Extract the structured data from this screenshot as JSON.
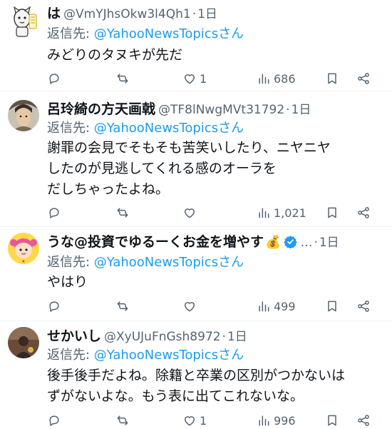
{
  "reply_prefix": "返信先: ",
  "tweets": [
    {
      "name": "は",
      "handle": "@VmYJhsOkw3l4Qh1",
      "sep": "·",
      "time": "1日",
      "reply_to": "@YahooNewsTopicsさん",
      "body": "みどりのタヌキが先だ",
      "likes": "1",
      "views": "686",
      "avatar": "cartoon-character"
    },
    {
      "name": "呂玲綺の方天画戟",
      "handle": "@TF8lNwgMVt31792",
      "sep": "·",
      "time": "1日",
      "reply_to": "@YahooNewsTopicsさん",
      "body": "謝罪の会見でそもそも苦笑いしたり、ニヤニヤ\nしたのが見逃してくれる感のオーラを\nだしちゃったよね。",
      "likes": "",
      "views": "1,021",
      "avatar": "game-character-portrait"
    },
    {
      "name": "うな@投資でゆるーくお金を増やす",
      "handle": "…",
      "sep": "·",
      "time": "1日",
      "reply_to": "@YahooNewsTopicsさん",
      "body": "やはり",
      "likes": "",
      "views": "499",
      "avatar": "cartoon-girl",
      "verified_color": "#1d9bf0",
      "name_emoji": "💰"
    },
    {
      "name": "せかいし",
      "handle": "@XyUJuFnGsh8972",
      "sep": "·",
      "time": "1日",
      "reply_to": "@YahooNewsTopicsさん",
      "body": "後手後手だよね。除籍と卒業の区別がつかないは\nずがないよな。もう表に出てこれないな。",
      "likes": "1",
      "views": "996",
      "avatar": "photo-figure"
    }
  ]
}
